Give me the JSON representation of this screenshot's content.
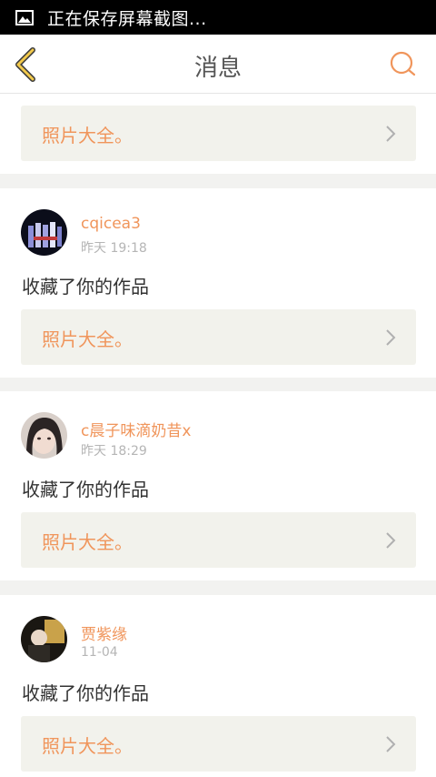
{
  "status_bar": {
    "text": "正在保存屏幕截图..."
  },
  "header": {
    "title": "消息"
  },
  "messages": [
    {
      "link": "照片大全。"
    },
    {
      "user": "cqicea3",
      "time": "昨天 19:18",
      "action": "收藏了你的作品",
      "link": "照片大全。"
    },
    {
      "user": "c晨子味滴奶昔x",
      "time": "昨天 18:29",
      "action": "收藏了你的作品",
      "link": "照片大全。"
    },
    {
      "user": "贾紫缘",
      "time": "11-04",
      "action": "收藏了你的作品",
      "link": "照片大全。"
    }
  ],
  "colors": {
    "accent": "#f0955b",
    "back_arrow": "#f2c94c",
    "box_bg": "#f2f2ec"
  }
}
